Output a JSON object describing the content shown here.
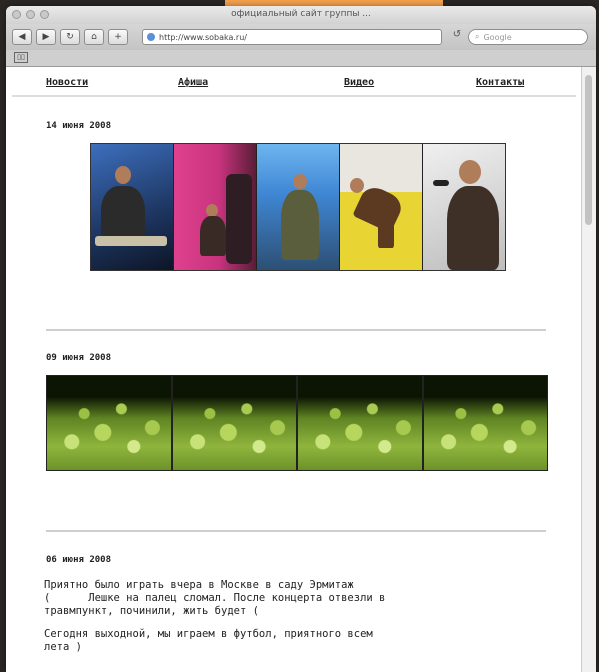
{
  "window": {
    "title": "официальный сайт группы ...",
    "url": "http://www.sobaka.ru/",
    "search_placeholder": "Google"
  },
  "nav": {
    "items": [
      {
        "label": "Новости"
      },
      {
        "label": "Афиша"
      },
      {
        "label": "Видео"
      },
      {
        "label": "Контакты"
      }
    ]
  },
  "posts": [
    {
      "date": "14 июня 2008"
    },
    {
      "date": "09 июня 2008"
    },
    {
      "date": "06 июня 2008",
      "text1": "Приятно было играть вчера в Москве в саду Эрмитаж",
      "text2": "(      Лешке на палец сломал. После концерта отвезли в",
      "text3": "травмпункт, починили, жить будет (",
      "text4": "Сегодня выходной, мы играем в футбол, приятного всем",
      "text5": "лета )"
    }
  ],
  "colors": {
    "photo_backgrounds": [
      "#2a4e86",
      "#d23a8a",
      "#4f9be0",
      "#e8d534",
      "#dcdcdc"
    ]
  }
}
